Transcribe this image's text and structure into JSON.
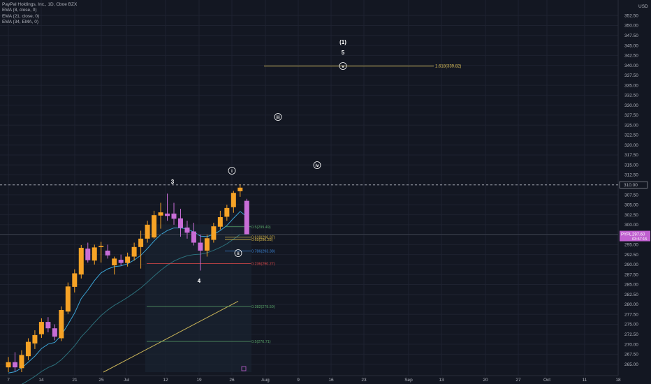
{
  "header": {
    "title": "PayPal Holdings, Inc., 1D, Cboe BZX",
    "indicators": [
      "EMA (8, close, 0)",
      "EMA (21, close, 0)",
      "EMA (34, EMA, 0)"
    ],
    "currency": "USD"
  },
  "colors": {
    "background": "#131722",
    "grid": "#1e2230",
    "up": "#f7a326",
    "down": "#c86dd7",
    "ema_fast": "#3ba4d6",
    "ema_slow": "#2c6f7a",
    "trend_line": "#c9b458",
    "ext_line": "#c9b458",
    "fib_green": "#5aa66a",
    "fib_red": "#e04a4a",
    "fib_blue": "#3b86d9",
    "fib_yellow": "#d6b84a",
    "price_tag": "#c060d0"
  },
  "chart_data": {
    "type": "candlestick",
    "symbol": "PYPL",
    "last_price_label": "297.60",
    "last_price_sublabel": "03:57:15",
    "last_price": 297.6,
    "ref_level_label": "310.00",
    "ref_level": 310.0,
    "ylim": [
      263,
      355
    ],
    "y_ticks": [
      "265.00",
      "267.50",
      "270.00",
      "272.50",
      "275.00",
      "277.50",
      "280.00",
      "282.50",
      "285.00",
      "287.50",
      "290.00",
      "292.50",
      "295.00",
      "297.50",
      "300.00",
      "302.50",
      "305.00",
      "307.50",
      "310.00",
      "312.50",
      "315.00",
      "317.50",
      "320.00",
      "322.50",
      "325.00",
      "327.50",
      "330.00",
      "332.50",
      "335.00",
      "337.50",
      "340.00",
      "342.50",
      "345.00",
      "347.50",
      "350.00",
      "352.50"
    ],
    "x_ticks": [
      "7",
      "14",
      "21",
      "25",
      "Jul",
      "12",
      "19",
      "26",
      "Aug",
      "9",
      "16",
      "23",
      "Sep",
      "13",
      "20",
      "27",
      "Oct",
      "11",
      "18"
    ],
    "candles": [
      {
        "o": 264.2,
        "h": 266.8,
        "l": 263.0,
        "c": 265.5
      },
      {
        "o": 265.5,
        "h": 268.0,
        "l": 263.2,
        "c": 264.2
      },
      {
        "o": 264.0,
        "h": 268.5,
        "l": 263.0,
        "c": 267.3
      },
      {
        "o": 267.0,
        "h": 271.5,
        "l": 266.0,
        "c": 270.6
      },
      {
        "o": 270.2,
        "h": 273.5,
        "l": 268.8,
        "c": 272.3
      },
      {
        "o": 272.5,
        "h": 276.5,
        "l": 271.6,
        "c": 275.6
      },
      {
        "o": 275.6,
        "h": 276.8,
        "l": 273.0,
        "c": 274.0
      },
      {
        "o": 274.0,
        "h": 275.0,
        "l": 271.0,
        "c": 271.9
      },
      {
        "o": 271.5,
        "h": 279.5,
        "l": 270.8,
        "c": 278.6
      },
      {
        "o": 278.2,
        "h": 285.5,
        "l": 277.6,
        "c": 284.5
      },
      {
        "o": 284.4,
        "h": 288.8,
        "l": 283.0,
        "c": 287.8
      },
      {
        "o": 287.5,
        "h": 294.9,
        "l": 286.5,
        "c": 294.2
      },
      {
        "o": 294.0,
        "h": 295.5,
        "l": 290.5,
        "c": 291.1
      },
      {
        "o": 291.0,
        "h": 295.0,
        "l": 290.0,
        "c": 294.3
      },
      {
        "o": 294.4,
        "h": 295.7,
        "l": 290.5,
        "c": 294.7
      },
      {
        "o": 293.5,
        "h": 295.0,
        "l": 291.5,
        "c": 292.3
      },
      {
        "o": 289.8,
        "h": 292.0,
        "l": 287.5,
        "c": 291.5
      },
      {
        "o": 291.2,
        "h": 292.5,
        "l": 289.8,
        "c": 290.4
      },
      {
        "o": 290.4,
        "h": 293.0,
        "l": 289.5,
        "c": 292.0
      },
      {
        "o": 292.0,
        "h": 295.5,
        "l": 291.0,
        "c": 294.4
      },
      {
        "o": 294.4,
        "h": 298.5,
        "l": 289.0,
        "c": 296.5
      },
      {
        "o": 296.5,
        "h": 301.0,
        "l": 295.5,
        "c": 300.0
      },
      {
        "o": 296.8,
        "h": 303.5,
        "l": 296.5,
        "c": 302.4
      },
      {
        "o": 302.3,
        "h": 305.5,
        "l": 299.0,
        "c": 303.1
      },
      {
        "o": 302.8,
        "h": 307.8,
        "l": 301.0,
        "c": 302.2
      },
      {
        "o": 302.8,
        "h": 305.5,
        "l": 300.0,
        "c": 301.5
      },
      {
        "o": 301.6,
        "h": 304.0,
        "l": 297.0,
        "c": 299.2
      },
      {
        "o": 299.3,
        "h": 301.0,
        "l": 296.5,
        "c": 298.0
      },
      {
        "o": 298.3,
        "h": 300.5,
        "l": 294.8,
        "c": 295.5
      },
      {
        "o": 295.5,
        "h": 297.5,
        "l": 288.5,
        "c": 293.5
      },
      {
        "o": 293.5,
        "h": 297.5,
        "l": 292.0,
        "c": 296.6
      },
      {
        "o": 296.2,
        "h": 300.5,
        "l": 295.5,
        "c": 299.6
      },
      {
        "o": 299.5,
        "h": 303.5,
        "l": 298.8,
        "c": 301.9
      },
      {
        "o": 302.0,
        "h": 305.0,
        "l": 301.0,
        "c": 304.2
      },
      {
        "o": 304.4,
        "h": 308.5,
        "l": 303.0,
        "c": 308.0
      },
      {
        "o": 308.4,
        "h": 310.1,
        "l": 307.0,
        "c": 309.3
      },
      {
        "o": 306.0,
        "h": 306.5,
        "l": 297.6,
        "c": 297.6
      }
    ],
    "fib_levels": [
      {
        "label": "0.5(299.49)",
        "value": 299.49,
        "color": "fib_green"
      },
      {
        "label": "0.618(296.87)",
        "value": 296.87,
        "color": "fib_yellow"
      },
      {
        "label": "0.65(296.28)",
        "value": 296.28,
        "color": "fib_yellow"
      },
      {
        "label": "0.786(293.38)",
        "value": 293.38,
        "color": "fib_blue"
      },
      {
        "label": "0.236(290.27)",
        "value": 290.27,
        "color": "fib_red"
      },
      {
        "label": "0.382(279.50)",
        "value": 279.5,
        "color": "fib_green"
      },
      {
        "label": "0.5(270.71)",
        "value": 270.71,
        "color": "fib_green"
      }
    ],
    "extension": {
      "label": "1.618(339.82)",
      "value": 339.82
    },
    "wave_labels": [
      "(1)",
      "5",
      "v",
      "iii",
      "iv",
      "i",
      "3",
      "ii",
      "4"
    ]
  }
}
